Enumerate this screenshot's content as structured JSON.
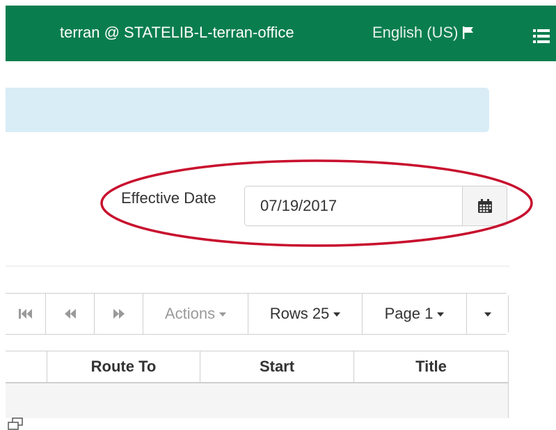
{
  "navbar": {
    "user": "terran @ STATELIB-L-terran-office",
    "language": "English (US)",
    "language_icon": "flag-icon",
    "menu_icon": "list-icon",
    "color": "#0a7d4f"
  },
  "banner": {
    "color": "#d9edf7"
  },
  "filter": {
    "effective_date_label": "Effective Date",
    "effective_date_value": "07/19/2017",
    "calendar_icon": "calendar-icon",
    "highlight_color": "#c8102e"
  },
  "toolbar": {
    "first_icon": "first-page-icon",
    "prev_icon": "previous-page-icon",
    "next_icon": "next-page-icon",
    "actions_label": "Actions",
    "rows_label": "Rows 25",
    "page_label": "Page 1"
  },
  "table": {
    "columns": [
      "",
      "Route To",
      "Start",
      "Title"
    ]
  },
  "footer": {
    "expand_icon": "expand-icon"
  }
}
